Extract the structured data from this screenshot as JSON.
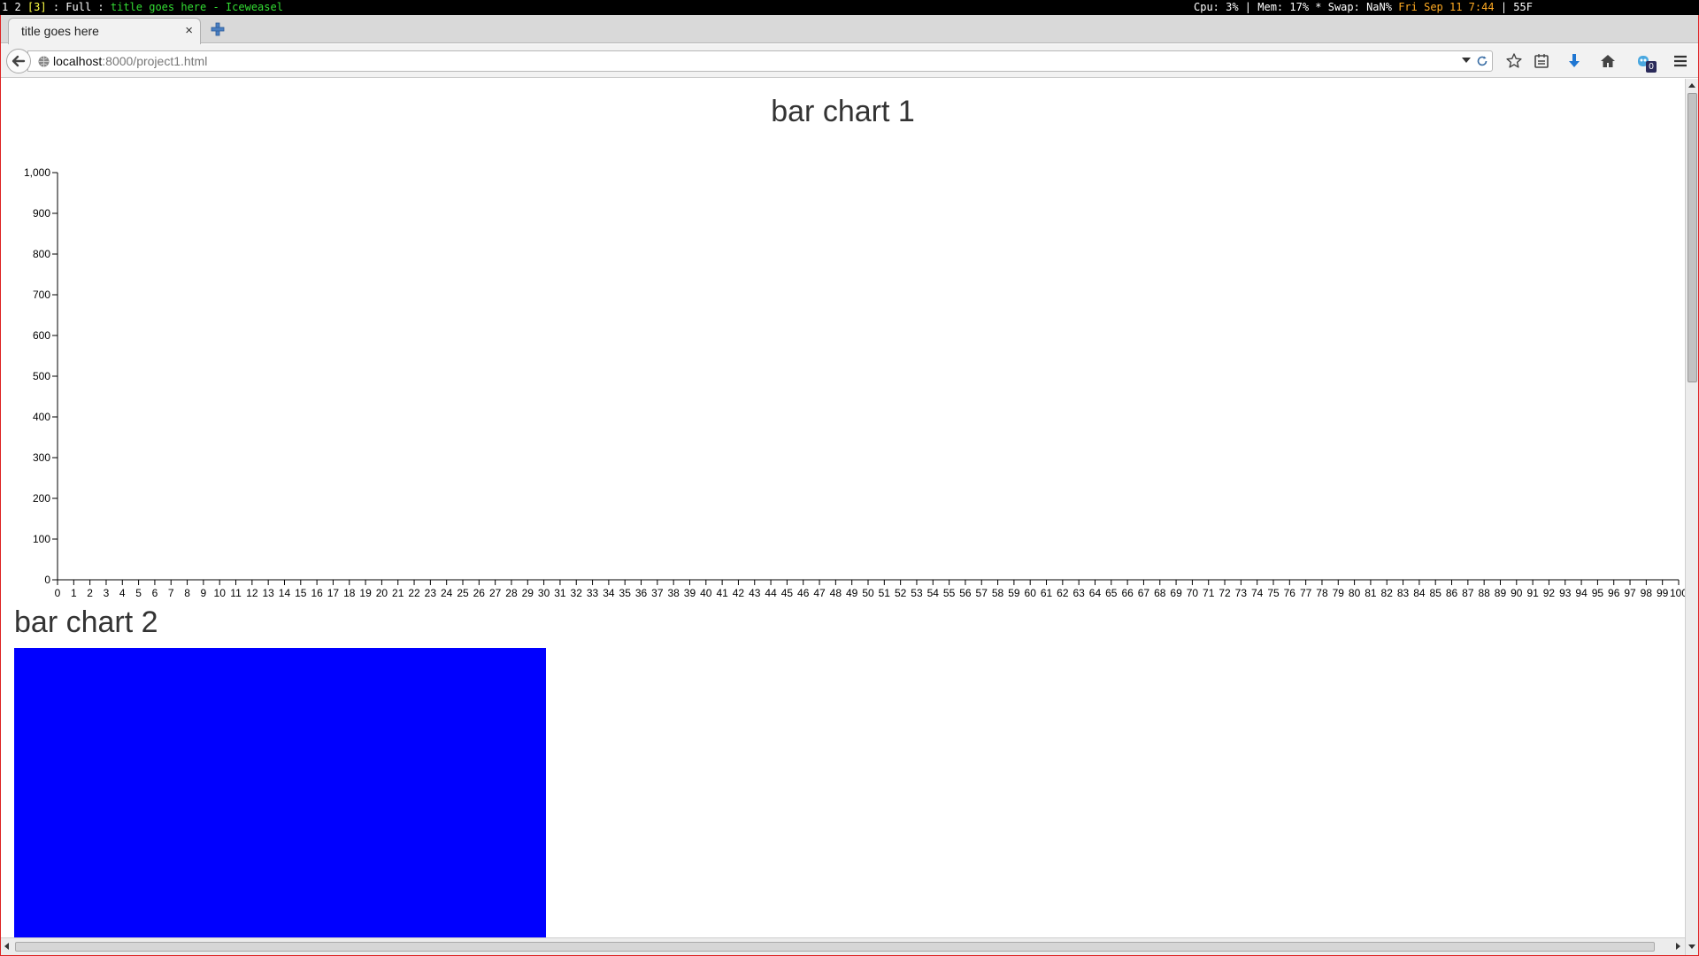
{
  "statusbar": {
    "workspaces": "1 2",
    "active_workspace": "[3]",
    "layout": ": Full :",
    "window_title": "title goes here - Iceweasel",
    "system": "Cpu: 3% | Mem: 17% * Swap: NaN%",
    "datetime": "Fri Sep 11  7:44",
    "weather": "| 55F"
  },
  "browser": {
    "tab_title": "title goes here",
    "tab_close": "×",
    "url_host": "localhost",
    "url_rest": ":8000/project1.html",
    "download_badge": "0",
    "icons": [
      "back-arrow-icon",
      "globe-icon",
      "reload-icon",
      "bookmark-star-icon",
      "reading-list-icon",
      "download-arrow-icon",
      "home-icon",
      "extension-icon",
      "hamburger-menu-icon",
      "new-tab-plus-icon"
    ]
  },
  "colors": {
    "bar2": "#0000ff",
    "axis": "#000000",
    "title": "#333333"
  },
  "chart_data": [
    {
      "type": "bar",
      "title": "bar chart 1",
      "ylim": [
        0,
        1000
      ],
      "yticks": [
        "0",
        "100",
        "200",
        "300",
        "400",
        "500",
        "600",
        "700",
        "800",
        "900",
        "1,000"
      ],
      "xticks": [
        "0",
        "1",
        "2",
        "3",
        "4",
        "5",
        "6",
        "7",
        "8",
        "9",
        "10",
        "11",
        "12",
        "13",
        "14",
        "15",
        "16",
        "17",
        "18",
        "19",
        "20",
        "21",
        "22",
        "23",
        "24",
        "25",
        "26",
        "27",
        "28",
        "29",
        "30",
        "31",
        "32",
        "33",
        "34",
        "35",
        "36",
        "37",
        "38",
        "39",
        "40",
        "41",
        "42",
        "43",
        "44",
        "45",
        "46",
        "47",
        "48",
        "49",
        "50",
        "51",
        "52",
        "53",
        "54",
        "55",
        "56",
        "57",
        "58",
        "59",
        "60",
        "61",
        "62",
        "63",
        "64",
        "65",
        "66",
        "67",
        "68",
        "69",
        "70",
        "71",
        "72",
        "73",
        "74",
        "75",
        "76",
        "77",
        "78",
        "79",
        "80",
        "81",
        "82",
        "83",
        "84",
        "85",
        "86",
        "87",
        "88",
        "89",
        "90",
        "91",
        "92",
        "93",
        "94",
        "95",
        "96",
        "97",
        "98",
        "99",
        "100"
      ],
      "values": []
    },
    {
      "type": "bar",
      "title": "bar chart 2",
      "categories": [
        ""
      ],
      "values": [
        1
      ]
    }
  ]
}
